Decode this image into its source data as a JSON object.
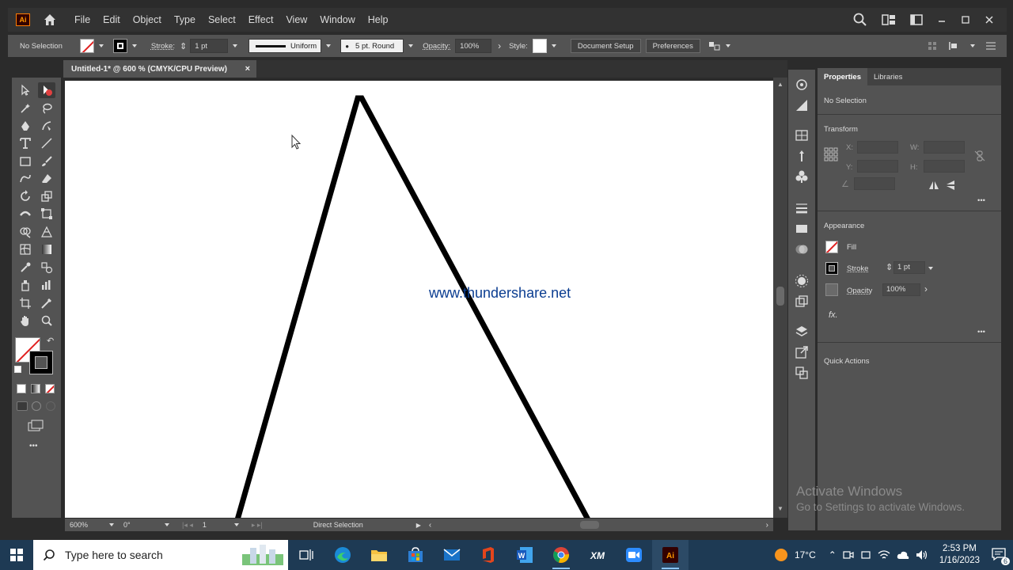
{
  "app": {
    "logo_text": "Ai",
    "menu": [
      "File",
      "Edit",
      "Object",
      "Type",
      "Select",
      "Effect",
      "View",
      "Window",
      "Help"
    ]
  },
  "control_bar": {
    "selection": "No Selection",
    "stroke_label": "Stroke:",
    "stroke_weight": "1 pt",
    "stroke_profile": "Uniform",
    "brush": "5 pt. Round",
    "opacity_label": "Opacity:",
    "opacity_value": "100%",
    "style_label": "Style:",
    "document_setup": "Document Setup",
    "preferences": "Preferences"
  },
  "document": {
    "tab_title": "Untitled-1* @ 600 % (CMYK/CPU Preview)",
    "close": "×",
    "watermark": "www.thundershare.net"
  },
  "status_bar": {
    "zoom": "600%",
    "rotation": "0°",
    "artboard": "1",
    "tool": "Direct Selection"
  },
  "properties": {
    "tabs": [
      "Properties",
      "Libraries"
    ],
    "selection": "No Selection",
    "transform_title": "Transform",
    "x_label": "X:",
    "y_label": "Y:",
    "w_label": "W:",
    "h_label": "H:",
    "appearance_title": "Appearance",
    "fill_label": "Fill",
    "stroke_label": "Stroke",
    "stroke_value": "1 pt",
    "opacity_label": "Opacity",
    "opacity_value": "100%",
    "fx_label": "fx.",
    "quick_actions_title": "Quick Actions",
    "more": "•••"
  },
  "activation": {
    "title": "Activate Windows",
    "subtitle": "Go to Settings to activate Windows."
  },
  "taskbar": {
    "search_placeholder": "Type here to search",
    "weather": "17°C",
    "time": "2:53 PM",
    "date": "1/16/2023",
    "notifications": "6",
    "apps": [
      "task-view",
      "edge",
      "file-explorer",
      "store",
      "mail",
      "office",
      "word",
      "chrome",
      "xm",
      "zoom",
      "illustrator"
    ]
  },
  "colors": {
    "accent_orange": "#ff9a00",
    "fill_none_red": "#e02020",
    "taskbar": "#1e3a54"
  }
}
